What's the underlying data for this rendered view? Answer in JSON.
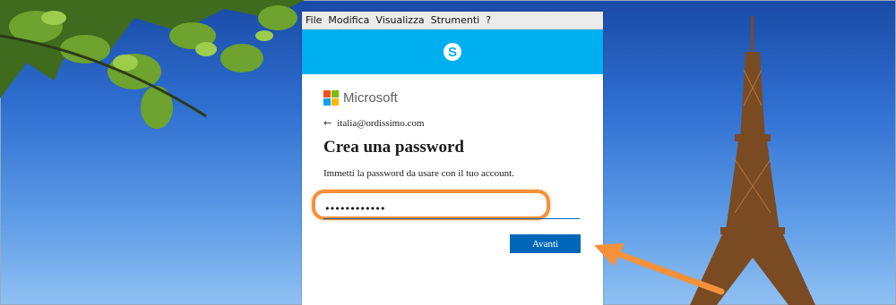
{
  "menubar": {
    "items": [
      "File",
      "Modifica",
      "Visualizza",
      "Strumenti",
      "?"
    ]
  },
  "skype": {
    "logo_letter": "S",
    "brand_color": "#00aff0"
  },
  "microsoft": {
    "name": "Microsoft",
    "logo_colors": [
      "#f25022",
      "#7fba00",
      "#00a4ef",
      "#ffb900"
    ]
  },
  "form": {
    "email": "italia@ordissimo.com",
    "title": "Crea una password",
    "description": "Immetti la password da usare con il tuo account.",
    "password_value": "••••••••••••",
    "submit_label": "Avanti",
    "accent": "#0067b8"
  },
  "annotation": {
    "highlight_color": "#f4913a"
  }
}
